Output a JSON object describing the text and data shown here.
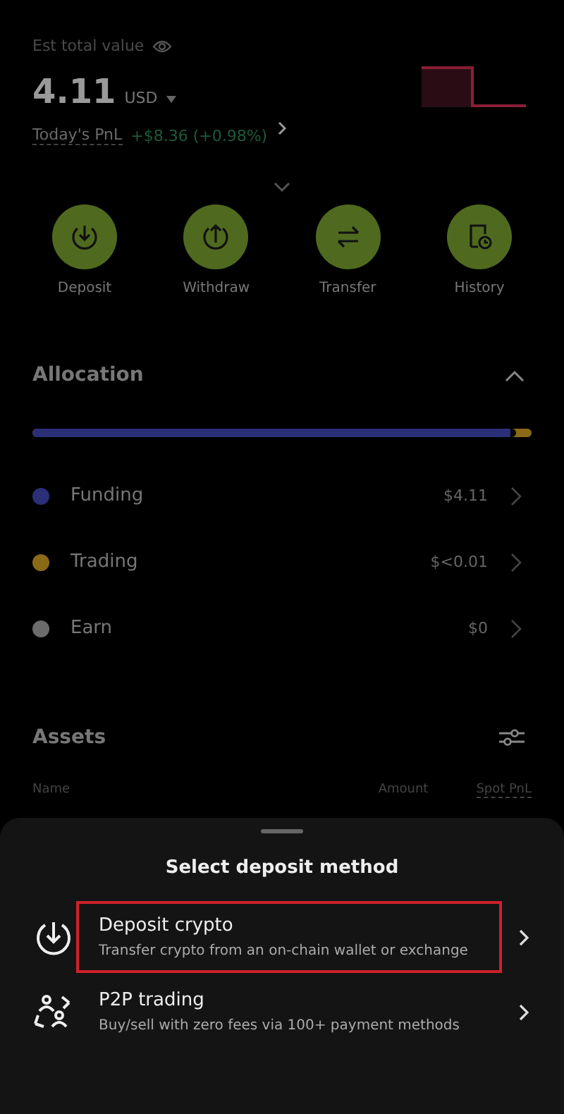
{
  "header": {
    "label": "Est total value",
    "value": "4.11",
    "currency": "USD",
    "pnl_label": "Today's PnL",
    "pnl_value": "+$8.36 (+0.98%)"
  },
  "actions": [
    {
      "label": "Deposit",
      "kind": "deposit"
    },
    {
      "label": "Withdraw",
      "kind": "withdraw"
    },
    {
      "label": "Transfer",
      "kind": "transfer"
    },
    {
      "label": "History",
      "kind": "history"
    }
  ],
  "allocation": {
    "title": "Allocation",
    "expanded": true,
    "level": 0.97,
    "items": [
      {
        "name": "Funding",
        "value": "$4.11",
        "color": "#2a2f78"
      },
      {
        "name": "Trading",
        "value": "$<0.01",
        "color": "#8a6a17"
      },
      {
        "name": "Earn",
        "value": "$0",
        "color": "#6b6b6b"
      }
    ]
  },
  "assets": {
    "title": "Assets",
    "columns": [
      "Name",
      "Amount",
      "Spot PnL"
    ]
  },
  "sheet": {
    "title": "Select deposit method",
    "options": [
      {
        "kind": "deposit",
        "title": "Deposit crypto",
        "subtitle": "Transfer crypto from an on-chain wallet or exchange",
        "highlighted": true
      },
      {
        "kind": "p2p",
        "title": "P2P trading",
        "subtitle": "Buy/sell with zero fees via 100+ payment methods",
        "highlighted": false
      }
    ]
  }
}
